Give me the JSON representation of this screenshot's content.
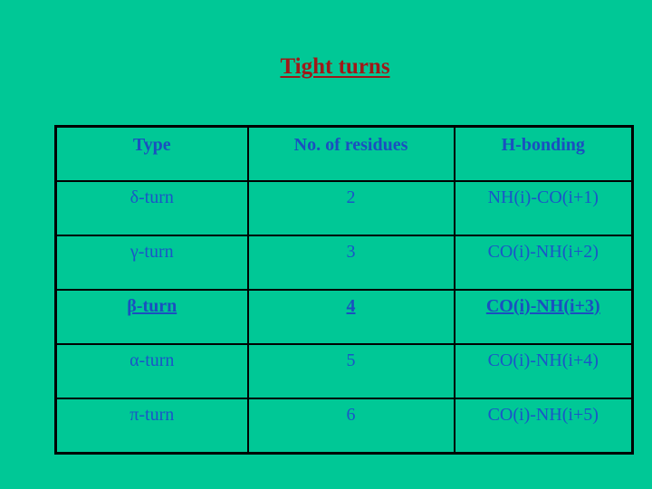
{
  "title": "Tight turns",
  "table": {
    "headers": [
      "Type",
      "No. of residues",
      "H-bonding"
    ],
    "rows": [
      {
        "type": "δ-turn",
        "residues": "2",
        "hbond": "NH(i)-CO(i+1)"
      },
      {
        "type": "γ-turn",
        "residues": "3",
        "hbond": "CO(i)-NH(i+2)"
      },
      {
        "type": "β-turn",
        "residues": "4",
        "hbond": "CO(i)-NH(i+3)"
      },
      {
        "type": "α-turn",
        "residues": "5",
        "hbond": "CO(i)-NH(i+4)"
      },
      {
        "type": "π-turn",
        "residues": "6",
        "hbond": "CO(i)-NH(i+5)"
      }
    ],
    "highlighted_row": 2
  },
  "colors": {
    "background": "#00C896",
    "title": "#A01818",
    "text": "#1A55C8",
    "border": "#000000"
  }
}
